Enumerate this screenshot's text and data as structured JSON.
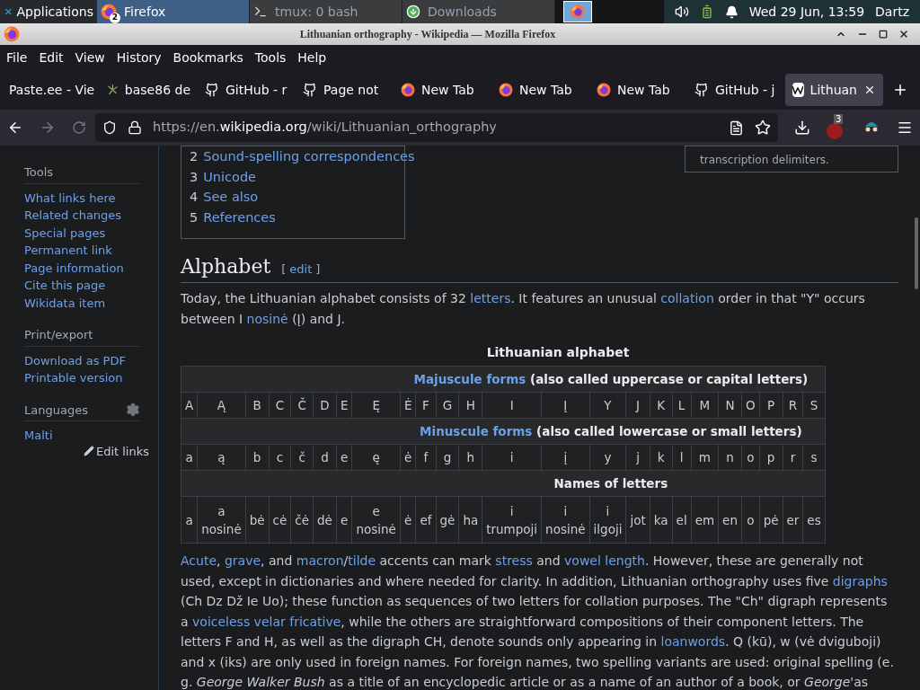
{
  "taskbar": {
    "apps_label": "Applications",
    "tasks": [
      {
        "label": "Firefox",
        "badge": "2",
        "kind": "firefox",
        "selected": true
      },
      {
        "label": "tmux: 0 bash",
        "kind": "terminal",
        "selected": false
      },
      {
        "label": "Downloads",
        "kind": "download",
        "selected": false
      }
    ],
    "clock": "Wed 29 Jun, 13:59",
    "user": "Dartz"
  },
  "window": {
    "title": "Lithuanian orthography - Wikipedia — Mozilla Firefox"
  },
  "menu": [
    "File",
    "Edit",
    "View",
    "History",
    "Bookmarks",
    "Tools",
    "Help"
  ],
  "tabs": [
    {
      "label": "Paste.ee - Vie",
      "kind": "paste",
      "selected": false
    },
    {
      "label": "base86 de",
      "kind": "spark",
      "selected": false
    },
    {
      "label": "GitHub - r",
      "kind": "github",
      "selected": false
    },
    {
      "label": "Page not",
      "kind": "github",
      "selected": false
    },
    {
      "label": "New Tab",
      "kind": "firefox",
      "selected": false
    },
    {
      "label": "New Tab",
      "kind": "firefox",
      "selected": false
    },
    {
      "label": "New Tab",
      "kind": "firefox",
      "selected": false
    },
    {
      "label": "GitHub - j",
      "kind": "github",
      "selected": false
    },
    {
      "label": "Lithuan",
      "kind": "wiki",
      "selected": true
    }
  ],
  "url": {
    "prefix": "https://en.",
    "domain": "wikipedia.org",
    "path": "/wiki/Lithuanian_orthography"
  },
  "ublock_badge": "3",
  "sidebar": {
    "sections": [
      {
        "heading": "Tools",
        "items": [
          "What links here",
          "Related changes",
          "Special pages",
          "Permanent link",
          "Page information",
          "Cite this page",
          "Wikidata item"
        ]
      },
      {
        "heading": "Print/export",
        "items": [
          "Download as PDF",
          "Printable version"
        ]
      },
      {
        "heading": "Languages",
        "items": [
          "Malti"
        ],
        "settings": true
      }
    ],
    "edit_links": "Edit links"
  },
  "toc": [
    {
      "num": "2",
      "label": "Sound-spelling correspondences"
    },
    {
      "num": "3",
      "label": "Unicode"
    },
    {
      "num": "4",
      "label": "See also"
    },
    {
      "num": "5",
      "label": "References"
    }
  ],
  "infobox_tail": "transcription delimiters.",
  "heading": {
    "title": "Alphabet",
    "edit": "edit",
    "bracket_open": "[",
    "bracket_close": "]"
  },
  "paragraph1": [
    {
      "kind": "text",
      "text": "Today, the Lithuanian alphabet consists of 32 "
    },
    {
      "kind": "link",
      "text": "letters"
    },
    {
      "kind": "text",
      "text": ". It features an unusual "
    },
    {
      "kind": "link",
      "text": "collation"
    },
    {
      "kind": "text",
      "text": " order in that \"Y\" occurs between I "
    },
    {
      "kind": "link",
      "text": "nosinė"
    },
    {
      "kind": "text",
      "text": " (Į) and J."
    }
  ],
  "table": {
    "caption": "Lithuanian alphabet",
    "sections": [
      {
        "link": "Majuscule forms",
        "rest": " (also called uppercase or capital letters)"
      },
      {
        "link": "Minuscule forms",
        "rest": " (also called lowercase or small letters)"
      },
      {
        "title": "Names of letters"
      }
    ],
    "upper": [
      "A",
      "Ą",
      "B",
      "C",
      "Č",
      "D",
      "E",
      "Ę",
      "Ė",
      "F",
      "G",
      "H",
      "I",
      "Į",
      "Y",
      "J",
      "K",
      "L",
      "M",
      "N",
      "O",
      "P",
      "R",
      "S"
    ],
    "lower": [
      "a",
      "ą",
      "b",
      "c",
      "č",
      "d",
      "e",
      "ę",
      "ė",
      "f",
      "g",
      "h",
      "i",
      "į",
      "y",
      "j",
      "k",
      "l",
      "m",
      "n",
      "o",
      "p",
      "r",
      "s"
    ],
    "names": [
      "a",
      "a nosinė",
      "bė",
      "cė",
      "čė",
      "dė",
      "e",
      "e nosinė",
      "ė",
      "ef",
      "gė",
      "ha",
      "i trumpoji",
      "i nosinė",
      "i ilgoji",
      "jot",
      "ka",
      "el",
      "em",
      "en",
      "o",
      "pė",
      "er",
      "es"
    ]
  },
  "paragraph2": [
    {
      "kind": "link",
      "text": "Acute"
    },
    {
      "kind": "text",
      "text": ", "
    },
    {
      "kind": "link",
      "text": "grave"
    },
    {
      "kind": "text",
      "text": ", and "
    },
    {
      "kind": "link",
      "text": "macron"
    },
    {
      "kind": "text",
      "text": "/"
    },
    {
      "kind": "link",
      "text": "tilde"
    },
    {
      "kind": "text",
      "text": " accents can mark "
    },
    {
      "kind": "link",
      "text": "stress"
    },
    {
      "kind": "text",
      "text": " and "
    },
    {
      "kind": "link",
      "text": "vowel length"
    },
    {
      "kind": "text",
      "text": ". However, these are generally not used, except in dictionaries and where needed for clarity. In addition, Lithuanian orthography uses five "
    },
    {
      "kind": "link",
      "text": "digraphs"
    },
    {
      "kind": "text",
      "text": " (Ch Dz Dž Ie Uo); these function as sequences of two letters for collation purposes. The \"Ch\" digraph represents a "
    },
    {
      "kind": "link",
      "text": "voiceless velar fricative"
    },
    {
      "kind": "text",
      "text": ", while the others are straightforward compositions of their component letters. The letters F and H, as well as the digraph CH, denote sounds only appearing in "
    },
    {
      "kind": "link",
      "text": "loanwords"
    },
    {
      "kind": "text",
      "text": ". Q (kū), w (vė dviguboji) and x (iks) are only used in foreign names. For foreign names, two spelling variants are used: original spelling (e. g. *George Walker Bush* as a title of an encyclopedic article or as a name of an author of a book, or *George*'as"
    }
  ]
}
